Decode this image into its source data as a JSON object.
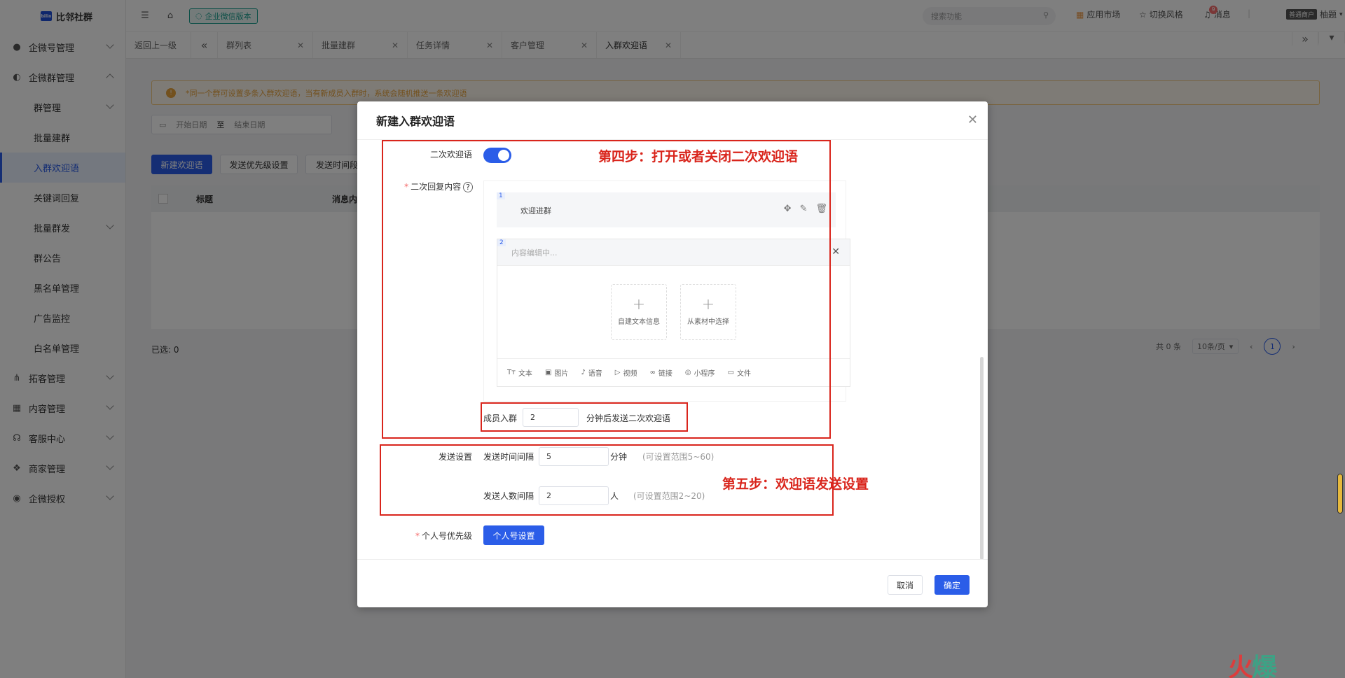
{
  "app": {
    "name": "比邻社群"
  },
  "sidebar": {
    "items": [
      {
        "label": "企微号管理",
        "icon": "wechat-icon"
      },
      {
        "label": "企微群管理",
        "icon": "group-users-icon"
      },
      {
        "label": "群管理"
      },
      {
        "label": "批量建群"
      },
      {
        "label": "入群欢迎语"
      },
      {
        "label": "关键词回复"
      },
      {
        "label": "批量群发"
      },
      {
        "label": "群公告"
      },
      {
        "label": "黑名单管理"
      },
      {
        "label": "广告监控"
      },
      {
        "label": "白名单管理"
      },
      {
        "label": "拓客管理",
        "icon": "network-icon"
      },
      {
        "label": "内容管理",
        "icon": "grid-icon"
      },
      {
        "label": "客服中心",
        "icon": "headset-icon"
      },
      {
        "label": "商家管理",
        "icon": "shop-icon"
      },
      {
        "label": "企微授权",
        "icon": "auth-icon"
      }
    ]
  },
  "topbar": {
    "edition": "企业微信版本",
    "search_placeholder": "搜索功能",
    "app_market": "应用市场",
    "switch_style": "切换风格",
    "messages": "消息",
    "message_count": "9",
    "user_tag": "普通商户",
    "user_name": "柚題"
  },
  "tabs": [
    {
      "label": "返回上一级"
    },
    {
      "label": "群列表"
    },
    {
      "label": "批量建群"
    },
    {
      "label": "任务详情"
    },
    {
      "label": "客户管理"
    },
    {
      "label": "入群欢迎语"
    }
  ],
  "page": {
    "notice": "*同一个群可设置多条入群欢迎语，当有新成员入群时，系统会随机推送一条欢迎语",
    "date_start": "开始日期",
    "date_to": "至",
    "date_end": "结束日期",
    "btn_new": "新建欢迎语",
    "btn_priority": "发送优先级设置",
    "btn_interval": "发送时间段",
    "col_title": "标题",
    "col_content": "消息内容",
    "selected": "已选: 0",
    "total": "共 0 条",
    "page_size": "10条/页",
    "current_page": "1"
  },
  "modal": {
    "title": "新建入群欢迎语",
    "second_welcome_label": "二次欢迎语",
    "second_reply_label": "二次回复内容",
    "msg1_index": "1",
    "msg1_text": "欢迎进群",
    "msg2_index": "2",
    "msg2_placeholder": "内容编辑中...",
    "add_custom_text": "自建文本信息",
    "add_from_material": "从素材中选择",
    "tools": [
      "文本",
      "图片",
      "语音",
      "视频",
      "链接",
      "小程序",
      "文件"
    ],
    "member_join": "成员入群",
    "delay_value": "2",
    "delay_suffix": "分钟后发送二次欢迎语",
    "send_settings_label": "发送设置",
    "time_interval_label": "发送时间间隔",
    "time_interval_value": "5",
    "time_unit": "分钟",
    "time_range_hint": "(可设置范围5~60)",
    "people_interval_label": "发送人数间隔",
    "people_interval_value": "2",
    "people_unit": "人",
    "people_range_hint": "(可设置范围2~20)",
    "priority_label": "个人号优先级",
    "priority_button": "个人号设置",
    "cancel": "取消",
    "confirm": "确定"
  },
  "annotations": {
    "step4": "第四步：打开或者关闭二次欢迎语",
    "step5": "第五步：欢迎语发送设置"
  },
  "colors": {
    "primary": "#2b5de8",
    "annotation": "#d9251c",
    "notice": "#e6a23c"
  }
}
